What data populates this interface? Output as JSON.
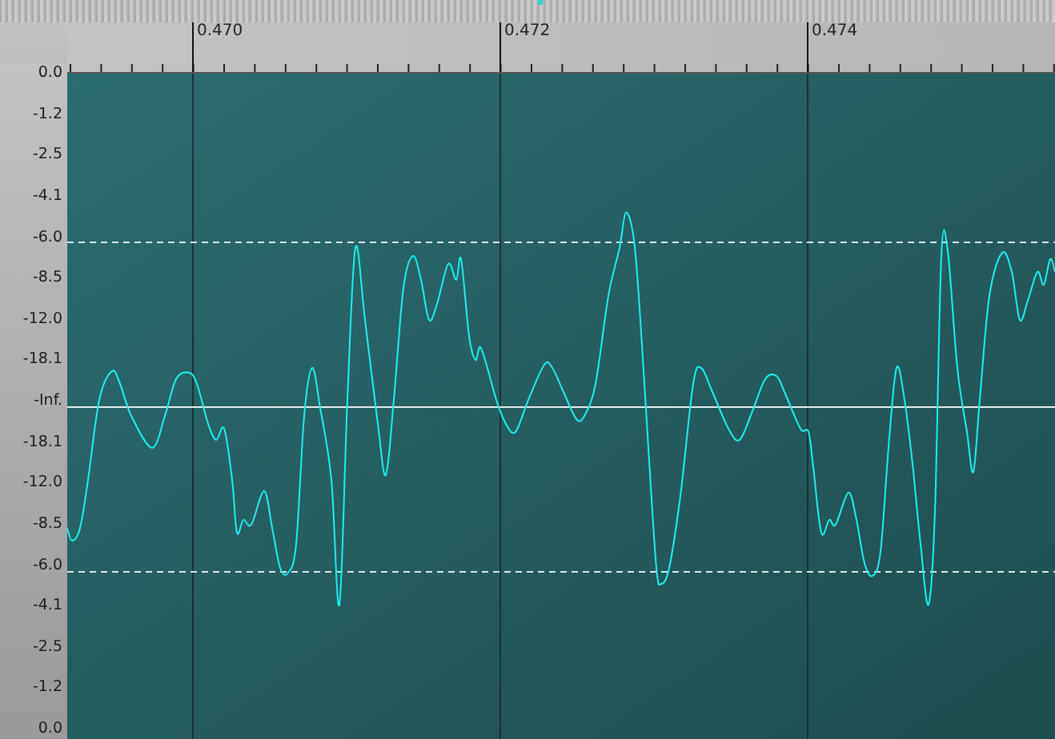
{
  "ruler": {
    "labels": [
      "0.470",
      "0.472",
      "0.474"
    ]
  },
  "scale": {
    "labels": [
      "0.0",
      "-1.2",
      "-2.5",
      "-4.1",
      "-6.0",
      "-8.5",
      "-12.0",
      "-18.1",
      "-Inf.",
      "-18.1",
      "-12.0",
      "-8.5",
      "-6.0",
      "-4.1",
      "-2.5",
      "-1.2",
      "0.0"
    ]
  }
}
